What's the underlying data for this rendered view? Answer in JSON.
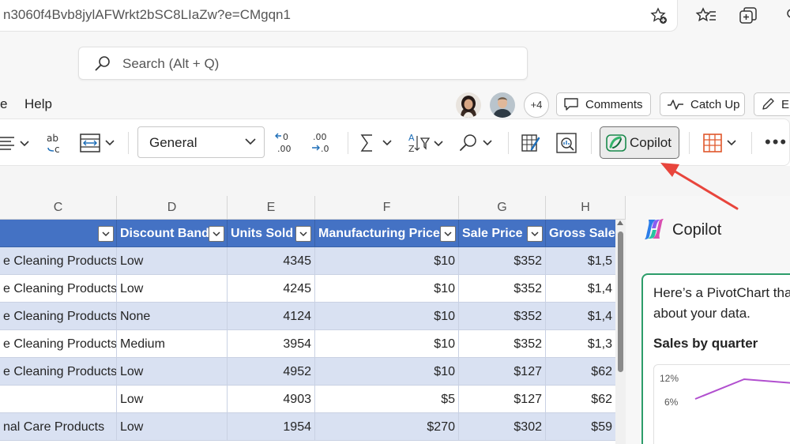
{
  "browser": {
    "url": "n3060f4Bvb8jylAFWrkt2bSC8LIaZw?e=CMgqn1",
    "icons": [
      "add-favorite-icon",
      "favorites-icon",
      "collections-icon",
      "profile-icon"
    ]
  },
  "header": {
    "search_placeholder": "Search (Alt + Q)",
    "menu_partial": "e",
    "menu_help": "Help",
    "avatar_more": "+4",
    "comments_label": "Comments",
    "catchup_label": "Catch Up",
    "edit_partial": "E"
  },
  "ribbon": {
    "number_format": "General",
    "copilot_label": "Copilot"
  },
  "grid": {
    "column_letters": [
      "C",
      "D",
      "E",
      "F",
      "G",
      "H"
    ],
    "headers": [
      "",
      "Discount Band",
      "Units Sold",
      "Manufacturing Price",
      "Sale Price",
      "Gross Sales"
    ],
    "rows": [
      [
        "e Cleaning Products",
        "Low",
        "4345",
        "$10",
        "$352",
        "$1,5"
      ],
      [
        "e Cleaning Products",
        "Low",
        "4245",
        "$10",
        "$352",
        "$1,4"
      ],
      [
        "e Cleaning Products",
        "None",
        "4124",
        "$10",
        "$352",
        "$1,4"
      ],
      [
        "e Cleaning Products",
        "Medium",
        "3954",
        "$10",
        "$352",
        "$1,3"
      ],
      [
        "e Cleaning Products",
        "Low",
        "4952",
        "$10",
        "$127",
        "$62"
      ],
      [
        "",
        "Low",
        "4903",
        "$5",
        "$127",
        "$62"
      ],
      [
        "nal Care Products",
        "Low",
        "1954",
        "$270",
        "$302",
        "$59"
      ]
    ]
  },
  "copilot_pane": {
    "title": "Copilot",
    "message": "Here’s a PivotChart tha about your data.",
    "message_line1": "Here’s a PivotChart tha",
    "message_line2": "about your data.",
    "chart_title": "Sales by quarter"
  },
  "chart_data": {
    "type": "line",
    "title": "Sales by quarter",
    "y_ticks": [
      "12%",
      "6%"
    ],
    "series": [
      {
        "values": [
          7,
          12,
          11
        ]
      }
    ],
    "ylim": [
      0,
      14
    ],
    "line_color": "#b14fcf"
  },
  "colors": {
    "table_header": "#4472c4",
    "table_band": "#d9e1f2",
    "copilot_card_border": "#2d9d6a",
    "annotation_arrow": "#e8453c"
  }
}
